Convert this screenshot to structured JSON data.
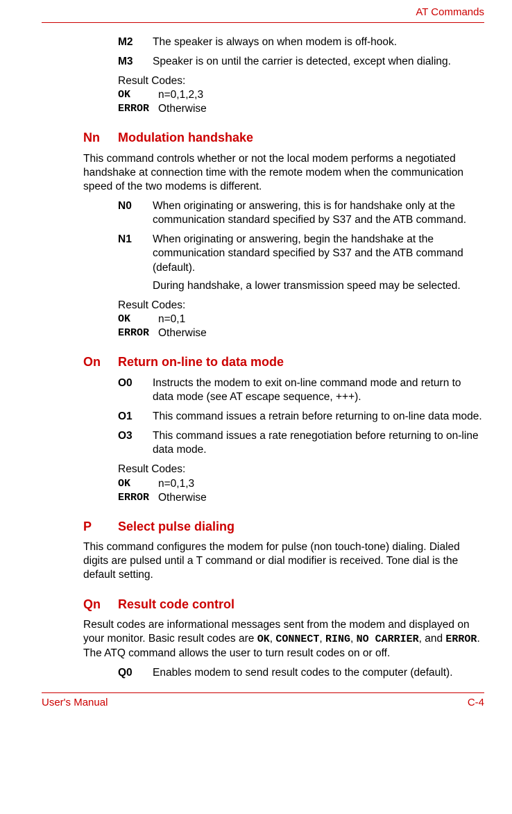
{
  "header": {
    "right": "AT Commands"
  },
  "footer": {
    "left": "User's Manual",
    "right": "C-4"
  },
  "m_section": {
    "items": [
      {
        "label": "M2",
        "desc": "The speaker is always on when modem is off-hook."
      },
      {
        "label": "M3",
        "desc": "Speaker is on until the carrier is detected, except when dialing."
      }
    ],
    "result": {
      "title": "Result Codes:",
      "ok": "OK",
      "ok_desc": "n=0,1,2,3",
      "err": "ERROR",
      "err_desc": "Otherwise"
    }
  },
  "nn_section": {
    "key": "Nn",
    "title": "Modulation handshake",
    "intro": "This command controls whether or not the local modem performs a negotiated handshake at connection time with the remote modem when the communication speed of the two modems is different.",
    "items": [
      {
        "label": "N0",
        "desc": "When originating or answering, this is for handshake only at the communication standard specified by S37 and the ATB command."
      },
      {
        "label": "N1",
        "desc": "When originating or answering, begin the handshake at the communication standard specified by S37 and the ATB command (default).",
        "desc2": "During handshake, a lower transmission speed may be selected."
      }
    ],
    "result": {
      "title": "Result Codes:",
      "ok": "OK",
      "ok_desc": "n=0,1",
      "err": "ERROR",
      "err_desc": "Otherwise"
    }
  },
  "on_section": {
    "key": "On",
    "title": "Return on-line to data mode",
    "items": [
      {
        "label": "O0",
        "desc": "Instructs the modem to exit on-line command mode and return to data mode (see AT escape sequence, +++)."
      },
      {
        "label": "O1",
        "desc": "This command issues a retrain before returning to on-line data mode."
      },
      {
        "label": "O3",
        "desc": "This command issues a rate renegotiation before returning to on-line data mode."
      }
    ],
    "result": {
      "title": "Result Codes:",
      "ok": "OK",
      "ok_desc": "n=0,1,3",
      "err": "ERROR",
      "err_desc": "Otherwise"
    }
  },
  "p_section": {
    "key": "P",
    "title": "Select pulse dialing",
    "intro": "This command configures the modem for pulse (non touch-tone) dialing. Dialed digits are pulsed until a T command or dial modifier is received. Tone dial is the default setting."
  },
  "qn_section": {
    "key": "Qn",
    "title": "Result code control",
    "intro_parts": {
      "p1": "Result codes are informational messages sent from the modem and displayed on your monitor. Basic result codes are ",
      "c1": "OK",
      "s1": ", ",
      "c2": "CONNECT",
      "s2": ", ",
      "c3": "RING",
      "s3": ", ",
      "c4": "NO CARRIER",
      "s4": ", and ",
      "c5": "ERROR",
      "p2": ". The ATQ command allows the user to turn result codes on or off."
    },
    "items": [
      {
        "label": "Q0",
        "desc": "Enables modem to send result codes to the computer (default)."
      }
    ]
  }
}
